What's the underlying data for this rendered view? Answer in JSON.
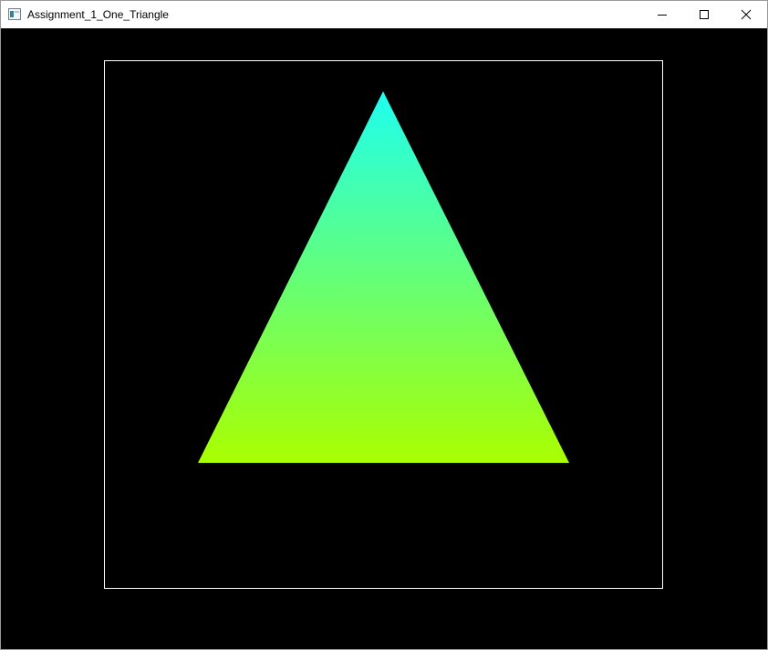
{
  "window": {
    "title": "Assignment_1_One_Triangle",
    "background": "#000000"
  },
  "titlebar": {
    "app_icon": "window-app-icon",
    "buttons": [
      {
        "name": "minimize",
        "icon": "minimize-icon"
      },
      {
        "name": "maximize",
        "icon": "maximize-icon"
      },
      {
        "name": "close",
        "icon": "close-icon"
      }
    ]
  },
  "scene": {
    "viewport_border_color": "#ffffff",
    "triangle": {
      "top_color": "#1efff0",
      "bottom_color": "#aaff00"
    }
  }
}
